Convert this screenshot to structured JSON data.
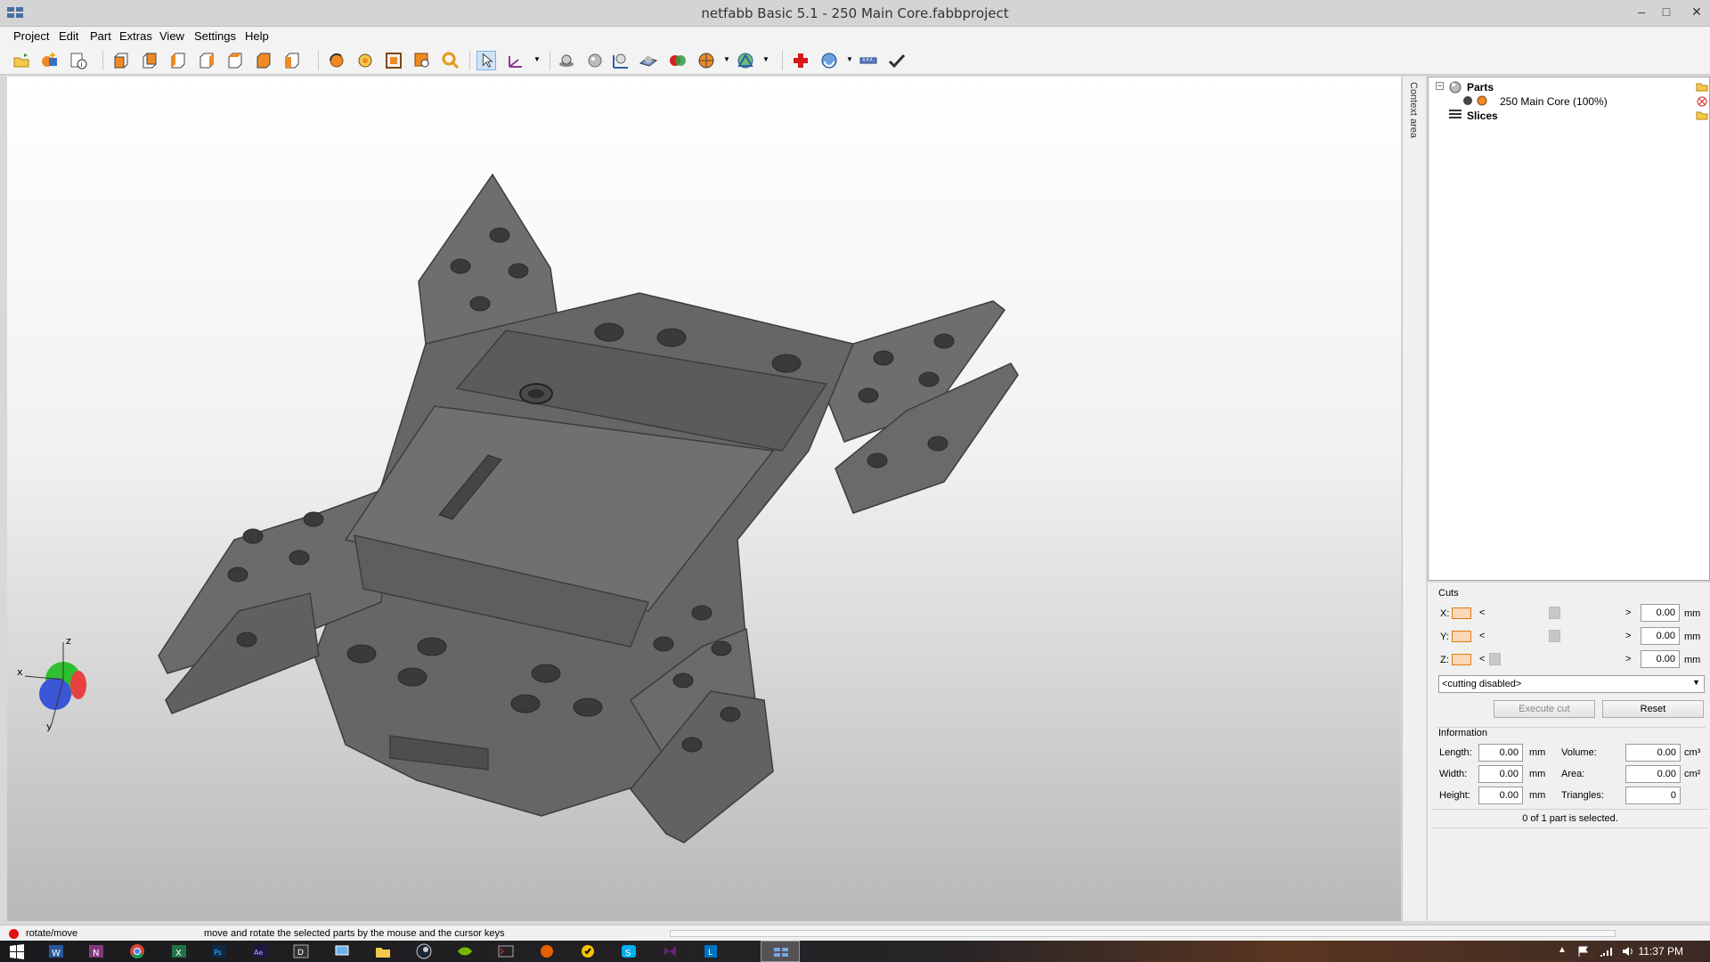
{
  "window": {
    "title": "netfabb Basic 5.1 - 250 Main Core.fabbproject"
  },
  "window_controls": {
    "minimize": "–",
    "maximize": "□",
    "close": "✕"
  },
  "menubar": {
    "items": [
      "Project",
      "Edit",
      "Part",
      "Extras",
      "View",
      "Settings",
      "Help"
    ]
  },
  "toolbar": {
    "icons": [
      "open-folder-icon",
      "add-part-icon",
      "info-icon",
      "view-front-icon",
      "view-back-icon",
      "view-left-icon",
      "view-right-icon",
      "view-top-icon",
      "view-bottom-icon",
      "view-iso-icon",
      "rotate-part-icon",
      "repair-icon",
      "fit-view-icon",
      "zoom-part-icon",
      "zoom-icon",
      "select-pointer-icon",
      "axis-tool-icon",
      "sphere-icon",
      "sphere-shaded-icon",
      "measure-icon",
      "plane-icon",
      "boolean-icon",
      "color-wheel-icon",
      "mesh-icon",
      "add-red-cross-icon",
      "analysis-icon",
      "ruler-icon",
      "checkmark-icon"
    ]
  },
  "side_tab": {
    "label": "Context area"
  },
  "tree": {
    "parts_label": "Parts",
    "part_item": "250 Main Core (100%)",
    "slices_label": "Slices"
  },
  "cuts": {
    "section_label": "Cuts",
    "rows": [
      {
        "axis": "X:",
        "value": "0.00",
        "unit": "mm",
        "thumb": 0.5
      },
      {
        "axis": "Y:",
        "value": "0.00",
        "unit": "mm",
        "thumb": 0.5
      },
      {
        "axis": "Z:",
        "value": "0.00",
        "unit": "mm",
        "thumb": 0.05
      }
    ],
    "dropdown_value": "<cutting disabled>",
    "execute_label": "Execute cut",
    "reset_label": "Reset"
  },
  "information": {
    "section_label": "Information",
    "length_label": "Length:",
    "length_value": "0.00",
    "length_unit": "mm",
    "width_label": "Width:",
    "width_value": "0.00",
    "width_unit": "mm",
    "height_label": "Height:",
    "height_value": "0.00",
    "height_unit": "mm",
    "volume_label": "Volume:",
    "volume_value": "0.00",
    "volume_unit": "cm³",
    "area_label": "Area:",
    "area_value": "0.00",
    "area_unit": "cm²",
    "triangles_label": "Triangles:",
    "triangles_value": "0",
    "selection_status": "0 of 1 part is selected."
  },
  "axis_gizmo": {
    "x": "x",
    "y": "y",
    "z": "z"
  },
  "statusbar": {
    "mode": "rotate/move",
    "hint": "move and rotate the selected parts by the mouse and the cursor keys"
  },
  "taskbar": {
    "clock": "11:37 PM",
    "apps": [
      "start-icon",
      "word-icon",
      "onenote-icon",
      "chrome-icon",
      "excel-icon",
      "photoshop-icon",
      "after-effects-icon",
      "daemon-icon",
      "network-icon",
      "explorer-icon",
      "steam-icon",
      "nvidia-icon",
      "terminal-icon",
      "firefox-icon",
      "norton-icon",
      "skype-icon",
      "vs-icon",
      "lync-icon",
      "netfabb-icon"
    ]
  },
  "colors": {
    "accent_orange": "#f08a24",
    "selected_blue": "#cfe3f7"
  }
}
